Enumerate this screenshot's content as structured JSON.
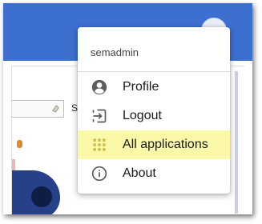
{
  "user_menu": {
    "username": "semadmin",
    "items": [
      {
        "label": "Profile",
        "icon": "account-circle-icon"
      },
      {
        "label": "Logout",
        "icon": "logout-icon"
      },
      {
        "label": "All applications",
        "icon": "apps-grid-icon",
        "highlighted": true
      },
      {
        "label": "About",
        "icon": "info-icon"
      }
    ]
  },
  "background": {
    "search_hint": "Se"
  },
  "colors": {
    "app_bar": "#3d6fd1",
    "highlight": "#fbf8a8",
    "apps_icon": "#c9b844"
  }
}
